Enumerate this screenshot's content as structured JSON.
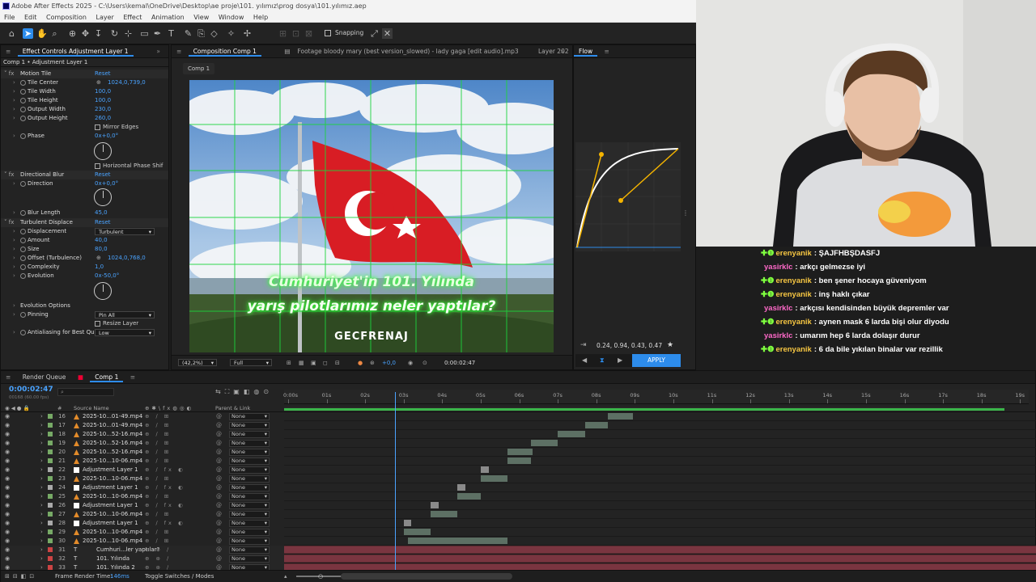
{
  "window": {
    "title": "Adobe After Effects 2025 - C:\\Users\\kemal\\OneDrive\\Desktop\\ae proje\\101. yılımız\\prog dosya\\101.yılımız.aep"
  },
  "menu": [
    "File",
    "Edit",
    "Composition",
    "Layer",
    "Effect",
    "Animation",
    "View",
    "Window",
    "Help"
  ],
  "toolbar": {
    "snapping": "Snapping"
  },
  "effect_controls": {
    "tab": "Effect Controls Adjustment Layer 1",
    "header": "Comp 1 • Adjustment Layer 1",
    "rows": [
      {
        "label": "Motion Tile",
        "value": "Reset",
        "kind": "fx"
      },
      {
        "label": "Tile Center",
        "value": "1024,0,739,0"
      },
      {
        "label": "Tile Width",
        "value": "100,0"
      },
      {
        "label": "Tile Height",
        "value": "100,0"
      },
      {
        "label": "Output Width",
        "value": "230,0"
      },
      {
        "label": "Output Height",
        "value": "260,0"
      },
      {
        "label": "",
        "value": "Mirror Edges",
        "kind": "check"
      },
      {
        "label": "Phase",
        "value": "0x+0,0°"
      },
      {
        "label": "",
        "value": "Horizontal Phase Shif",
        "kind": "check"
      },
      {
        "label": "Directional Blur",
        "value": "Reset",
        "kind": "fx"
      },
      {
        "label": "Direction",
        "value": "0x+0,0°"
      },
      {
        "label": "Blur Length",
        "value": "45,0"
      },
      {
        "label": "Turbulent Displace",
        "value": "Reset",
        "kind": "fx"
      },
      {
        "label": "Displacement",
        "value": "Turbulent",
        "kind": "dd"
      },
      {
        "label": "Amount",
        "value": "40,0"
      },
      {
        "label": "Size",
        "value": "80,0"
      },
      {
        "label": "Offset (Turbulence)",
        "value": "1024,0,768,0"
      },
      {
        "label": "Complexity",
        "value": "1,0"
      },
      {
        "label": "Evolution",
        "value": "0x-50,0°"
      },
      {
        "label": "Evolution Options",
        "value": ""
      },
      {
        "label": "Pinning",
        "value": "Pin All",
        "kind": "dd"
      },
      {
        "label": "",
        "value": "Resize Layer",
        "kind": "check"
      },
      {
        "label": "Antialiasing for Best Qual",
        "value": "Low",
        "kind": "dd"
      }
    ]
  },
  "composition": {
    "tabs": [
      "Composition Comp 1",
      "Footage bloody mary (best version_slowed) - lady gaga [edit audio].mp3",
      "Layer 202"
    ],
    "breadcrumb": "Comp 1",
    "overlay_line1": "Cumhuriyet'in 101. Yılında",
    "overlay_line2": "yarış pilotlarımız neler yaptılar?",
    "watermark": "GECFRENAJ",
    "zoom": "(42,2%)",
    "quality": "Full",
    "exposure": "+0,0",
    "timecode": "0:00:02:47"
  },
  "flow": {
    "title": "Flow",
    "values": "0.24, 0.94, 0.43, 0.47",
    "apply": "APPLY",
    "accent": "#f5b400"
  },
  "timeline": {
    "tabs": [
      "Render Queue",
      "Comp 1"
    ],
    "timecode": "0:00:02:47",
    "subcode": "00168 (60.00 fps)",
    "col_source": "Source Name",
    "col_parent": "Parent & Link",
    "ruler": [
      "0:00s",
      "01s",
      "02s",
      "03s",
      "04s",
      "05s",
      "06s",
      "07s",
      "08s",
      "09s",
      "10s",
      "11s",
      "12s",
      "13s",
      "14s",
      "15s",
      "16s",
      "17s",
      "18s",
      "19s"
    ],
    "playhead_seconds": 2.78,
    "footer_label": "Frame Render Time:",
    "footer_value": "146ms",
    "footer_toggle": "Toggle Switches / Modes",
    "layers": [
      {
        "num": "16",
        "name": "2025-10...01-49.mp4",
        "type": "video",
        "parent": "None",
        "start": 8.3,
        "end": 8.95
      },
      {
        "num": "17",
        "name": "2025-10...01-49.mp4",
        "type": "video",
        "parent": "None",
        "start": 7.7,
        "end": 8.3
      },
      {
        "num": "18",
        "name": "2025-10...52-16.mp4",
        "type": "video",
        "parent": "None",
        "start": 7.0,
        "end": 7.7
      },
      {
        "num": "19",
        "name": "2025-10...52-16.mp4",
        "type": "video",
        "parent": "None",
        "start": 6.3,
        "end": 7.0
      },
      {
        "num": "20",
        "name": "2025-10...52-16.mp4",
        "type": "video",
        "parent": "None",
        "start": 5.7,
        "end": 6.35
      },
      {
        "num": "21",
        "name": "2025-10...10-06.mp4",
        "type": "video",
        "parent": "None",
        "start": 5.7,
        "end": 6.3
      },
      {
        "num": "22",
        "name": "Adjustment Layer 1",
        "type": "adjust",
        "parent": "None",
        "start": 5.0,
        "end": 5.2
      },
      {
        "num": "23",
        "name": "2025-10...10-06.mp4",
        "type": "video",
        "parent": "None",
        "start": 5.0,
        "end": 5.7
      },
      {
        "num": "24",
        "name": "Adjustment Layer 1",
        "type": "adjust",
        "parent": "None",
        "start": 4.4,
        "end": 4.6
      },
      {
        "num": "25",
        "name": "2025-10...10-06.mp4",
        "type": "video",
        "parent": "None",
        "start": 4.4,
        "end": 5.0
      },
      {
        "num": "26",
        "name": "Adjustment Layer 1",
        "type": "adjust",
        "parent": "None",
        "start": 3.7,
        "end": 3.9
      },
      {
        "num": "27",
        "name": "2025-10...10-06.mp4",
        "type": "video",
        "parent": "None",
        "start": 3.7,
        "end": 4.4
      },
      {
        "num": "28",
        "name": "Adjustment Layer 1",
        "type": "adjust",
        "parent": "None",
        "start": 3.0,
        "end": 3.2
      },
      {
        "num": "29",
        "name": "2025-10...10-06.mp4",
        "type": "video",
        "parent": "None",
        "start": 3.0,
        "end": 3.7
      },
      {
        "num": "30",
        "name": "2025-10...10-06.mp4",
        "type": "video",
        "parent": "None",
        "start": 3.1,
        "end": 5.7
      },
      {
        "num": "31",
        "name": "Cumhuri...ler yaptılar?",
        "type": "text",
        "parent": "None",
        "start": 0,
        "end": 19.4
      },
      {
        "num": "32",
        "name": "101. Yılında",
        "type": "text",
        "parent": "None",
        "start": 0,
        "end": 19.4
      },
      {
        "num": "33",
        "name": "101. Yılında 2",
        "type": "text",
        "parent": "None",
        "start": 0,
        "end": 19.4
      }
    ]
  },
  "chat": [
    {
      "badge": true,
      "user": "erenyanik",
      "msg": ": ŞAJFHBŞDASFJ",
      "color": "#f5c542"
    },
    {
      "badge": false,
      "user": "yasirklc",
      "msg": ": arkçı gelmezse iyi",
      "color": "#ff69c9"
    },
    {
      "badge": true,
      "user": "erenyanik",
      "msg": ": ben şener hocaya güveniyom",
      "color": "#f5c542"
    },
    {
      "badge": true,
      "user": "erenyanik",
      "msg": ": inş haklı çıkar",
      "color": "#f5c542"
    },
    {
      "badge": false,
      "user": "yasirklc",
      "msg": ": arkçısı kendisinden büyük depremler var",
      "color": "#ff69c9"
    },
    {
      "badge": true,
      "user": "erenyanik",
      "msg": ": aynen mask 6 larda bişi olur diyodu",
      "color": "#f5c542"
    },
    {
      "badge": false,
      "user": "yasirklc",
      "msg": ": umarım hep 6 larda dolaşır durur",
      "color": "#ff69c9"
    },
    {
      "badge": true,
      "user": "erenyanik",
      "msg": ": 6 da bile yıkılan binalar var rezillik",
      "color": "#f5c542"
    }
  ]
}
